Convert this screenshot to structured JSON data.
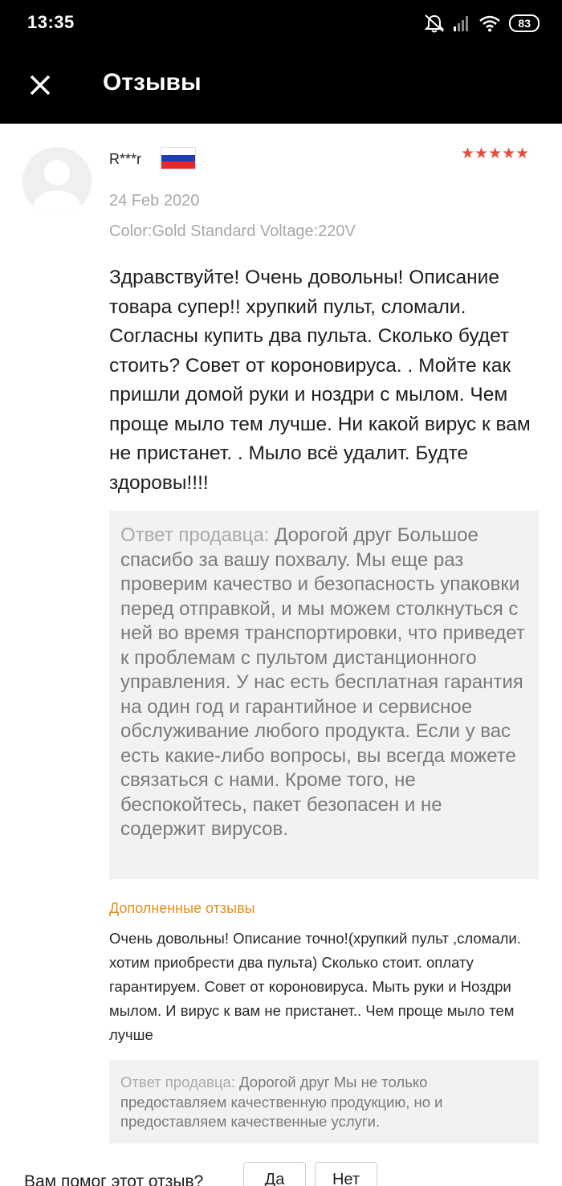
{
  "status_bar": {
    "time": "13:35",
    "battery": "83",
    "icons": [
      "mute-icon",
      "signal-icon",
      "wifi-icon",
      "battery-icon"
    ]
  },
  "app_bar": {
    "title": "Отзывы",
    "close_icon": "close-icon"
  },
  "review": {
    "reviewer": "R***r",
    "country_flag": "russia-flag",
    "rating": 5,
    "stars": "★★★★★",
    "date": "24 Feb 2020",
    "attributes": "Color:Gold Standard Voltage:220V",
    "text": "Здравствуйте! Очень довольны! Описание товара супер!!  хрупкий пульт, сломали. Согласны купить два пульта. Сколько будет стоить? Совет от короновируса. . Мойте как пришли домой  руки и ноздри с мылом. Чем проще мыло тем лучше. Ни какой вирус к вам не пристанет. . Мыло всё удалит. Будте здоровы!!!!",
    "seller_reply": {
      "label": "Ответ продавца:",
      "text": "Дорогой друг Большое спасибо за вашу похвалу. Мы еще раз проверим качество и безопасность упаковки перед отправкой, и мы можем столкнуться с ней во время транспортировки, что приведет к проблемам с пультом дистанционного управления. У нас есть бесплатная гарантия на один год и гарантийное и сервисное обслуживание любого продукта. Если у вас есть какие-либо вопросы, вы всегда можете связаться с нами. Кроме того, не беспокойтесь, пакет безопасен и не содержит вирусов."
    },
    "followup": {
      "title": "Дополненные отзывы",
      "text": "Очень довольны! Описание точно!(хрупкий пульт ,сломали. хотим приобрести два пульта) Сколько стоит. оплату гарантируем. Совет от короновируса. Мыть руки и Ноздри мылом.  И вирус к вам не пристанет.. Чем проще мыло тем лучше",
      "seller_reply": {
        "label": "Ответ продавца:",
        "text": "Дорогой друг Мы не только предоставляем качественную продукцию, но и предоставляем качественные услуги."
      }
    }
  },
  "helpful": {
    "question": "Вам помог этот отзыв?",
    "yes_label": "Да",
    "no_label": "Нет"
  },
  "colors": {
    "accent_orange": "#e0901c",
    "star_red": "#e94b3c",
    "header_black": "#000000",
    "reply_bg": "#f2f2f2"
  }
}
